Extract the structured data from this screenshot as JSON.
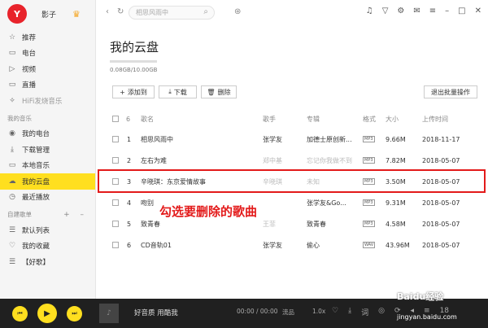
{
  "user": {
    "avatar": "Y",
    "name": "影子"
  },
  "sidebar": {
    "items": [
      {
        "icon": "☆",
        "label": "推荐"
      },
      {
        "icon": "▭",
        "label": "电台"
      },
      {
        "icon": "▷",
        "label": "视频"
      },
      {
        "icon": "▭",
        "label": "直播"
      },
      {
        "icon": "✧",
        "label": "HiFi发烧音乐"
      }
    ],
    "my_music_title": "我的音乐",
    "my_music": [
      {
        "icon": "◉",
        "label": "我的电台"
      },
      {
        "icon": "⤓",
        "label": "下载管理"
      },
      {
        "icon": "▭",
        "label": "本地音乐"
      },
      {
        "icon": "☁",
        "label": "我的云盘"
      },
      {
        "icon": "◷",
        "label": "最近播放"
      }
    ],
    "playlists_title": "自建歌单",
    "playlist_ops": "+ –",
    "playlists": [
      {
        "icon": "☰",
        "label": "默认列表"
      },
      {
        "icon": "♡",
        "label": "我的收藏"
      },
      {
        "icon": "☰",
        "label": "【好歌】"
      }
    ]
  },
  "topbar": {
    "search_placeholder": "相思风雨中"
  },
  "page": {
    "title": "我的云盘",
    "quota": "0.08GB/10.00GB",
    "buttons": {
      "add": "添加到",
      "download": "下载",
      "delete": "删除",
      "exit_batch": "退出批量操作"
    }
  },
  "table": {
    "headers": {
      "count": "6",
      "title": "歌名",
      "artist": "歌手",
      "album": "专辑",
      "format": "格式",
      "size": "大小",
      "uploaded": "上传时间"
    },
    "rows": [
      {
        "num": "1",
        "title": "相思风雨中",
        "artist": "张学友",
        "album": "加德士原创新...",
        "format": "MP3",
        "size": "9.66M",
        "uploaded": "2018-11-17"
      },
      {
        "num": "2",
        "title": "左右为难",
        "artist": "郑中基",
        "album": "忘记你我做不到",
        "format": "MP3",
        "size": "7.82M",
        "uploaded": "2018-05-07"
      },
      {
        "num": "3",
        "title": "辛晓琪：东京爱情故事",
        "artist": "辛晓琪",
        "album": "未知",
        "format": "MP3",
        "size": "3.50M",
        "uploaded": "2018-05-07"
      },
      {
        "num": "4",
        "title": "吻别",
        "artist": "",
        "album": "张学友&Go...",
        "format": "MP3",
        "size": "9.31M",
        "uploaded": "2018-05-07"
      },
      {
        "num": "5",
        "title": "致青春",
        "artist": "王菲",
        "album": "致青春",
        "format": "MP3",
        "size": "4.58M",
        "uploaded": "2018-05-07"
      },
      {
        "num": "6",
        "title": "CD音轨01",
        "artist": "张学友",
        "album": "偷心",
        "format": "WAV",
        "size": "43.96M",
        "uploaded": "2018-05-07"
      }
    ]
  },
  "annotation": "勾选要删除的歌曲",
  "player": {
    "song": "好音质 用酷我",
    "time": "00:00 / 00:00",
    "quality": "流品",
    "speed": "1.0x",
    "count": "18"
  },
  "watermark": {
    "brand": "Baidu经验",
    "url": "jingyan.baidu.com"
  },
  "colors": {
    "accent": "#ffdf1f",
    "highlight_box": "#e31a1a",
    "player_bg": "#202020"
  }
}
